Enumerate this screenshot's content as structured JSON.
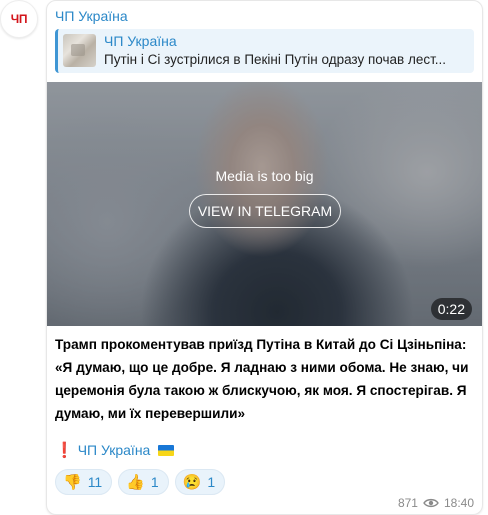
{
  "channel": {
    "avatar_text": "ЧП",
    "name": "ЧП Україна"
  },
  "reply": {
    "author": "ЧП Україна",
    "text": "Путін і Сі зустрілися в Пекіні Путін одразу почав лест..."
  },
  "media": {
    "notice": "Media is too big",
    "button_label": "VIEW IN TELEGRAM",
    "duration": "0:22"
  },
  "post": {
    "line1": "Трамп прокоментував приїзд Путіна в Китай до Сі Цзіньпіна:",
    "line2": "«Я думаю, що це добре. Я ладнаю з ними обома. Не знаю, чи церемонія була такою ж блискучою, як моя. Я спостерігав. Я думаю, ми їх перевершили»"
  },
  "signature": {
    "mark": "❗",
    "link": "ЧП Україна",
    "flag": "ukraine-flag"
  },
  "reactions": [
    {
      "emoji": "👎",
      "count": "11",
      "icon": "thumbs-down-icon"
    },
    {
      "emoji": "👍",
      "count": "1",
      "icon": "thumbs-up-icon"
    },
    {
      "emoji": "😢",
      "count": "1",
      "icon": "crying-face-icon"
    }
  ],
  "meta": {
    "views": "871",
    "time": "18:40"
  },
  "colors": {
    "link": "#2b88c8",
    "accent_bar": "#3f96d4",
    "reply_bg": "#ebf4fb"
  }
}
